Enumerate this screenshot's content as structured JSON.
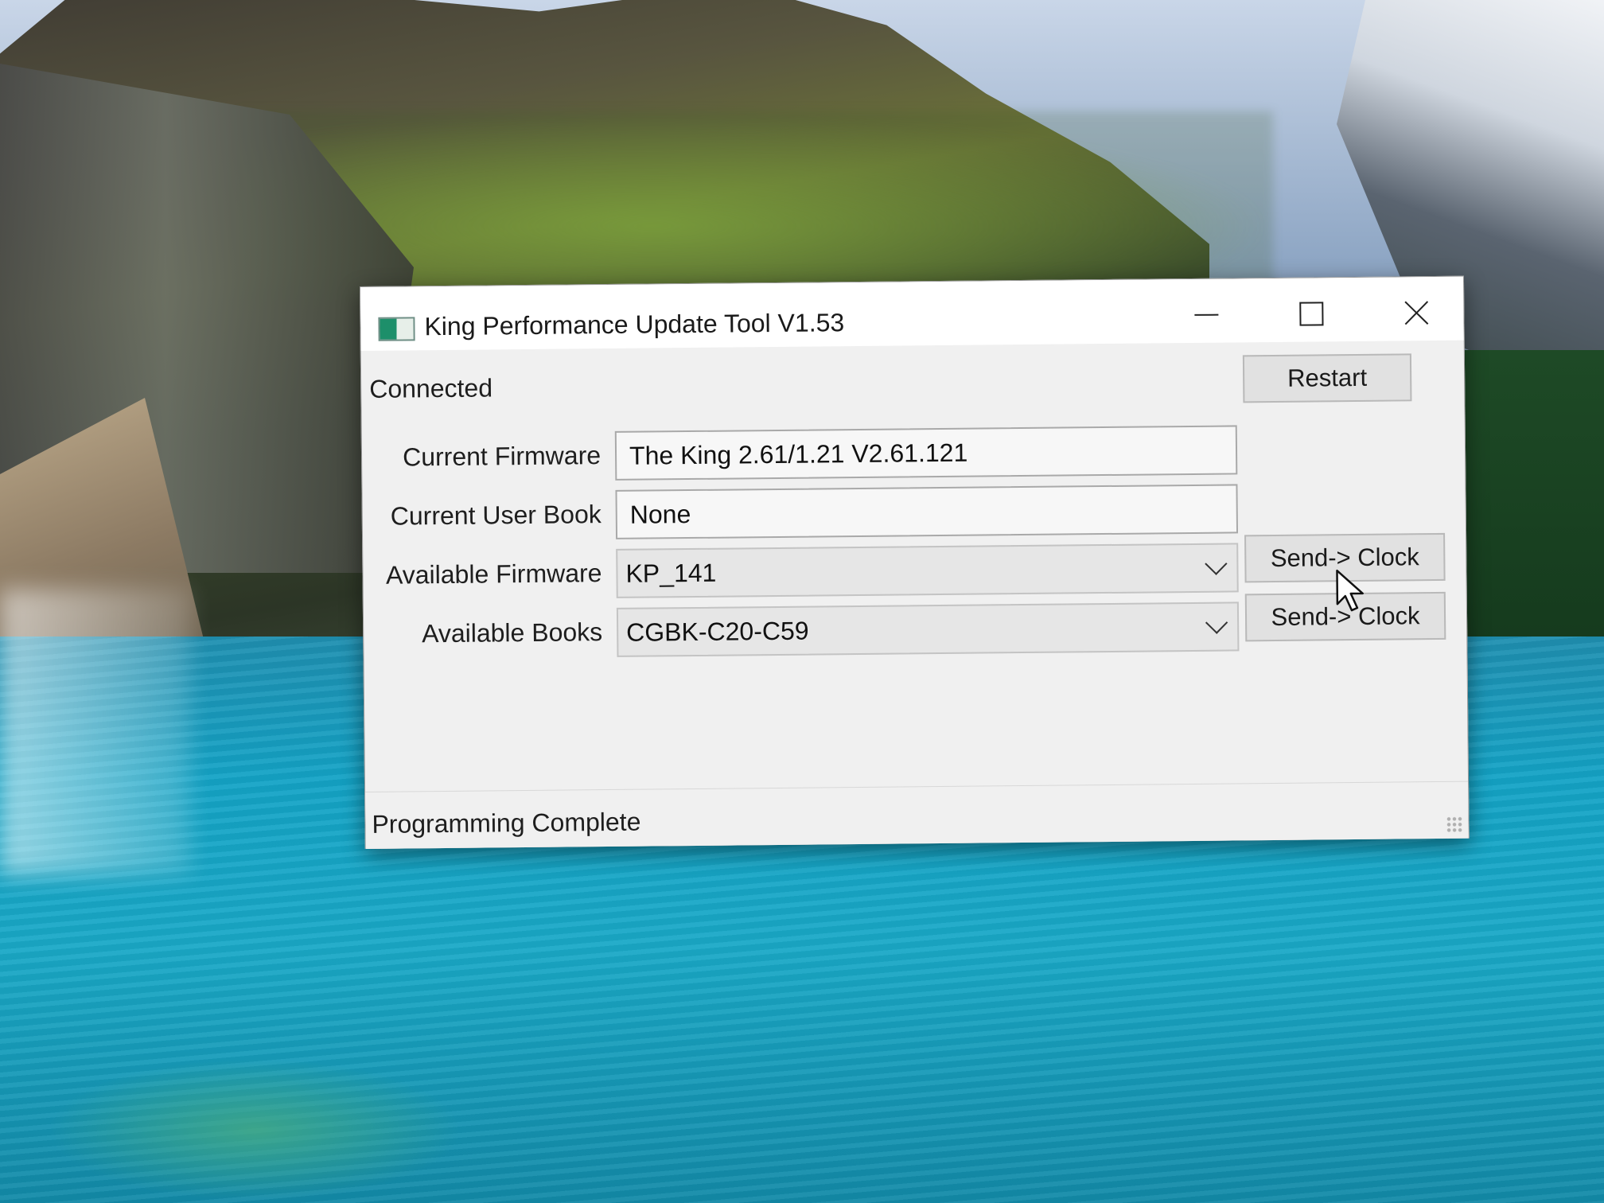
{
  "window": {
    "title": "King Performance Update Tool V1.53"
  },
  "connection_status": "Connected",
  "buttons": {
    "restart": "Restart",
    "send_firmware": "Send-> Clock",
    "send_books": "Send-> Clock"
  },
  "fields": {
    "current_firmware": {
      "label": "Current Firmware",
      "value": "The King 2.61/1.21 V2.61.121"
    },
    "current_user_book": {
      "label": "Current User Book",
      "value": "None"
    },
    "available_firmware": {
      "label": "Available Firmware",
      "selected": "KP_141"
    },
    "available_books": {
      "label": "Available Books",
      "selected": "CGBK-C20-C59"
    }
  },
  "status_bar": {
    "text": "Programming Complete"
  },
  "icons": {
    "app": "app-icon",
    "minimize": "minimize-icon",
    "maximize": "maximize-icon",
    "close": "close-icon",
    "dropdown": "chevron-down-icon",
    "cursor": "mouse-pointer-icon"
  },
  "colors": {
    "window_bg": "#f0f0f0",
    "titlebar_bg": "#ffffff",
    "button_bg": "#e1e1e1"
  }
}
